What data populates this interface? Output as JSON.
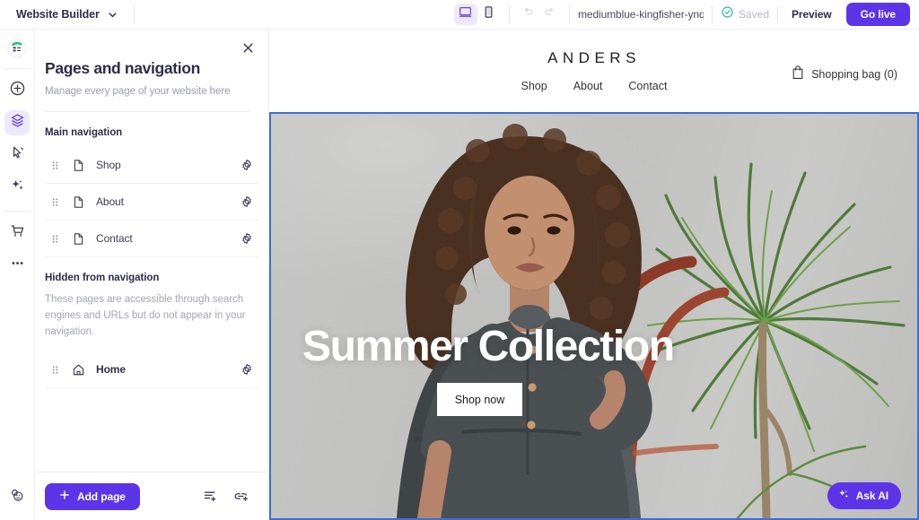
{
  "topbar": {
    "app_title": "Website Builder",
    "chevron_icon": "chevron-down-icon",
    "desktop_icon": "desktop-device-icon",
    "mobile_icon": "mobile-device-icon",
    "undo_icon": "undo-icon",
    "redo_icon": "redo-icon",
    "site_url": "mediumblue-kingfisher-ynqj…",
    "saved_icon": "check-circle-icon",
    "saved_label": "Saved",
    "preview_label": "Preview",
    "golive_label": "Go live",
    "accent_color": "#5c35e8",
    "saved_color": "#2bbb9c",
    "active_device": "desktop"
  },
  "rail": {
    "logo_icon": "app-logo-icon",
    "items": [
      {
        "icon": "plus-circle-icon",
        "name": "add-element",
        "active": false
      },
      {
        "icon": "layers-icon",
        "name": "pages-layers",
        "active": true
      },
      {
        "icon": "cursor-click-icon",
        "name": "interactions",
        "active": false
      },
      {
        "icon": "sparkles-icon",
        "name": "ai-tools",
        "active": false
      },
      {
        "icon": "shopping-cart-icon",
        "name": "store",
        "active": false
      },
      {
        "icon": "ellipsis-icon",
        "name": "more-options",
        "active": false
      }
    ],
    "help_icon": "help-chat-icon"
  },
  "panel": {
    "close_icon": "close-icon",
    "title": "Pages and navigation",
    "subtitle": "Manage every page of your website here",
    "main_nav": {
      "heading": "Main navigation",
      "pages": [
        {
          "label": "Shop",
          "icon": "page-file-icon",
          "bold": false
        },
        {
          "label": "About",
          "icon": "page-file-icon",
          "bold": false
        },
        {
          "label": "Contact",
          "icon": "page-file-icon",
          "bold": false
        }
      ]
    },
    "hidden_nav": {
      "heading": "Hidden from navigation",
      "description": "These pages are accessible through search engines and URLs but do not appear in your navigation.",
      "pages": [
        {
          "label": "Home",
          "icon": "home-icon",
          "bold": true
        }
      ]
    },
    "footer": {
      "add_page_label": "Add page",
      "add_page_icon": "plus-icon",
      "add_section_icon": "add-list-item-icon",
      "add_link_icon": "add-link-icon"
    },
    "row_drag_icon": "drag-handle-icon",
    "row_settings_icon": "gear-icon"
  },
  "site": {
    "brand": "ANDERS",
    "nav": [
      {
        "label": "Shop"
      },
      {
        "label": "About"
      },
      {
        "label": "Contact"
      }
    ],
    "bag_icon": "shopping-bag-icon",
    "bag_label": "Shopping bag (0)",
    "hero": {
      "title": "Summer Collection",
      "cta_label": "Shop now",
      "selection_color": "#3b6fd4"
    }
  },
  "ask_ai": {
    "label": "Ask AI",
    "icon": "sparkles-icon"
  }
}
